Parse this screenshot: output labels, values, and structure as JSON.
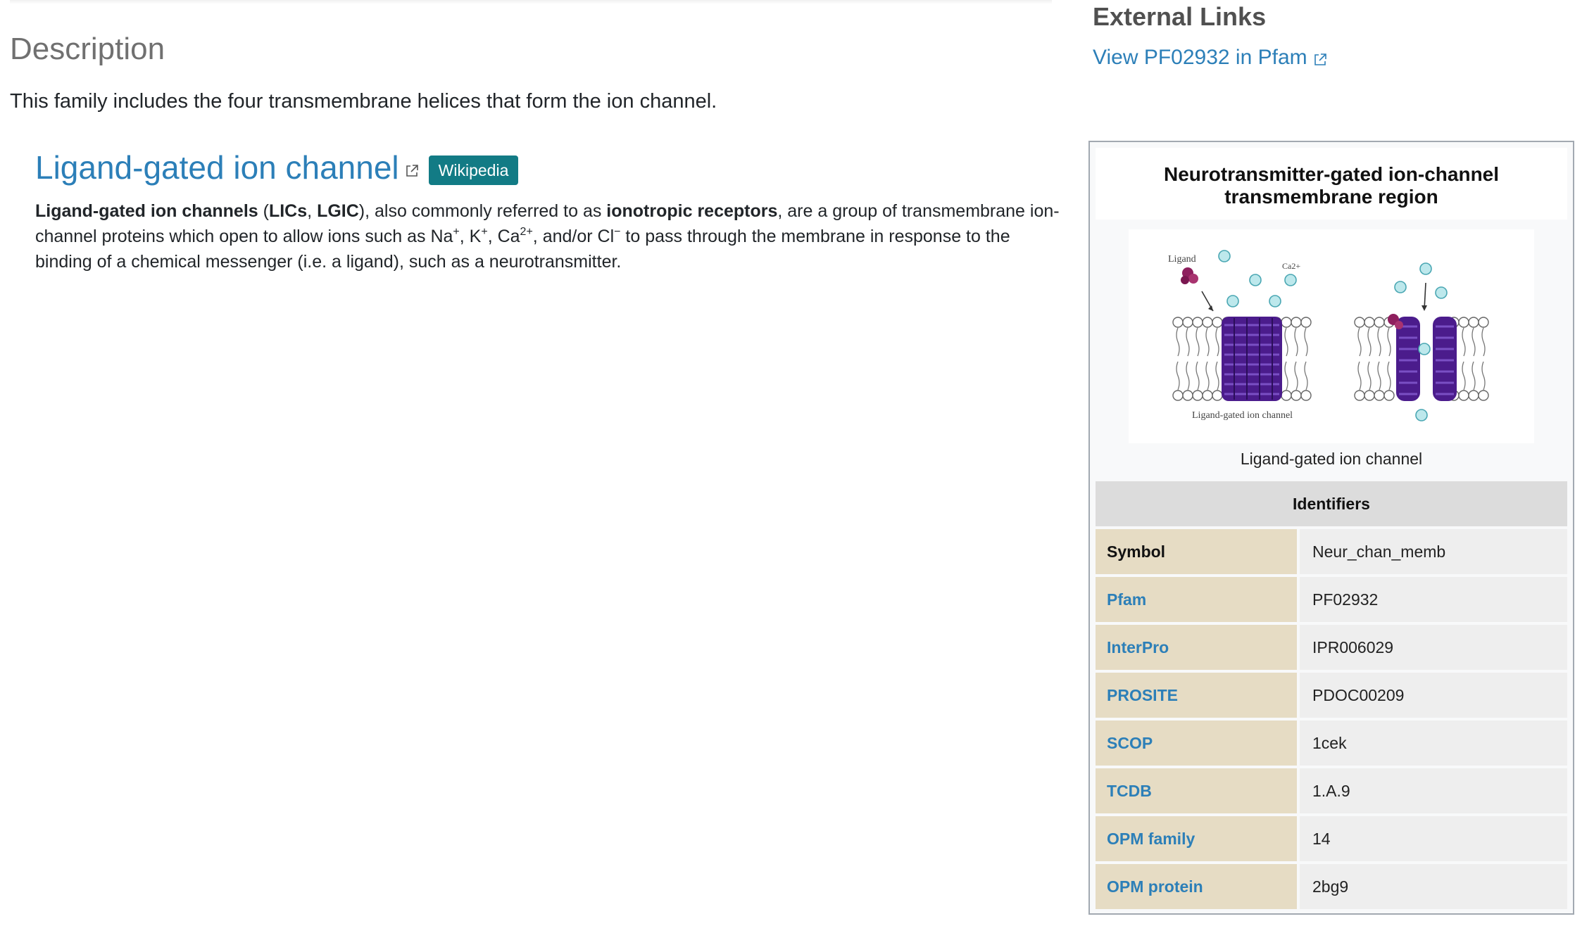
{
  "description": {
    "title": "Description",
    "text": "This family includes the four transmembrane helices that form the ion channel."
  },
  "wikipedia": {
    "title": "Ligand-gated ion channel",
    "badge": "Wikipedia",
    "t1_bold": "Ligand-gated ion channels",
    "t2": " (",
    "t3_bold": "LICs",
    "t4": ", ",
    "t5_bold": "LGIC",
    "t6": "), also commonly referred to as ",
    "t7_bold": "ionotropic receptors",
    "t8": ", are a group of transmembrane ion-channel proteins which open to allow ions such as Na",
    "sup1": "+",
    "t9": ", K",
    "sup2": "+",
    "t10": ", Ca",
    "sup3": "2+",
    "t11": ", and/or Cl",
    "sup4": "−",
    "t12": " to pass through the membrane in response to the binding of a chemical messenger (i.e. a ligand), such as a neurotransmitter."
  },
  "external_links": {
    "title": "External Links",
    "pfam_link": "View PF02932 in Pfam"
  },
  "infobox": {
    "title": "Neurotransmitter-gated ion-channel transmembrane region",
    "image_labels": {
      "ligand": "Ligand",
      "ca": "Ca2+",
      "channel": "Ligand-gated ion channel"
    },
    "caption": "Ligand-gated ion channel",
    "section": "Identifiers",
    "rows": [
      {
        "key": "Symbol",
        "value": "Neur_chan_memb"
      },
      {
        "key": "Pfam",
        "value": "PF02932"
      },
      {
        "key": "InterPro",
        "value": "IPR006029"
      },
      {
        "key": "PROSITE",
        "value": "PDOC00209"
      },
      {
        "key": "SCOP",
        "value": "1cek"
      },
      {
        "key": "TCDB",
        "value": "1.A.9"
      },
      {
        "key": "OPM family",
        "value": "14"
      },
      {
        "key": "OPM protein",
        "value": "2bg9"
      }
    ]
  },
  "colors": {
    "link": "#2c7fb8",
    "badge": "#127b85",
    "key_bg": "#e6dcc4",
    "value_bg": "#eeeeee",
    "section_bg": "#dcdcdc",
    "protein": "#4b1c8c",
    "ligand": "#8e1f5e",
    "ion": "#bde8ec"
  },
  "icons": {
    "external": "external-link-icon"
  }
}
